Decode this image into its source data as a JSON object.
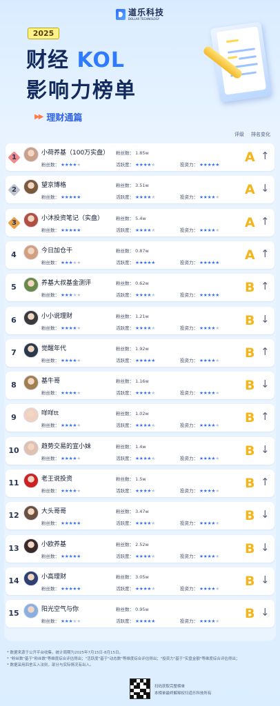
{
  "brand": {
    "cn": "道乐科技",
    "en": "DOLLAR TECHNOLOGY"
  },
  "year": "2025",
  "title": {
    "line1_a": "财经",
    "line1_b": "KOL",
    "line2": "影响力榜单"
  },
  "subtitle": "理财通篇",
  "columns": {
    "grade": "评级",
    "change": "排名变化"
  },
  "labels": {
    "fans": "粉丝数：",
    "fans_short": "粉丝数：",
    "active": "活跃度：",
    "invest": "投资力："
  },
  "rows": [
    {
      "rank": "1",
      "name": "小荷养基（100万实盘）",
      "fans": "1.85w",
      "s1": 4,
      "s2": 4,
      "s3": 5,
      "grade": "A",
      "trend": "↑"
    },
    {
      "rank": "2",
      "name": "望京博格",
      "fans": "3.51w",
      "s1": 5,
      "s2": 4,
      "s3": 4,
      "grade": "A",
      "trend": "↓"
    },
    {
      "rank": "3",
      "name": "小沐投资笔记（实盘）",
      "fans": "5.4w",
      "s1": 5,
      "s2": 4,
      "s3": 4,
      "grade": "A",
      "trend": "↑"
    },
    {
      "rank": "4",
      "name": "今日加仓干",
      "fans": "0.87w",
      "s1": 3,
      "s2": 5,
      "s3": 5,
      "grade": "A",
      "trend": "↑"
    },
    {
      "rank": "5",
      "name": "养基大叔基金测评",
      "fans": "0.62w",
      "s1": 3,
      "s2": 4,
      "s3": 5,
      "grade": "B",
      "trend": "↑"
    },
    {
      "rank": "6",
      "name": "小小说理财",
      "fans": "1.21w",
      "s1": 4,
      "s2": 4,
      "s3": 4,
      "grade": "B",
      "trend": "↓"
    },
    {
      "rank": "7",
      "name": "觉醒年代",
      "fans": "1.92w",
      "s1": 4,
      "s2": 5,
      "s3": 4,
      "grade": "B",
      "trend": "↑"
    },
    {
      "rank": "8",
      "name": "基牛哥",
      "fans": "1.16w",
      "s1": 4,
      "s2": 4,
      "s3": 4,
      "grade": "B",
      "trend": "↓"
    },
    {
      "rank": "9",
      "name": "咩咩tt",
      "fans": "1.02w",
      "s1": 4,
      "s2": 4,
      "s3": 4,
      "grade": "B",
      "trend": "↑"
    },
    {
      "rank": "10",
      "name": "趋势交易的宣小妹",
      "fans": "1.4w",
      "s1": 4,
      "s2": 4,
      "s3": 4,
      "grade": "B",
      "trend": "↓"
    },
    {
      "rank": "11",
      "name": "老王说投资",
      "fans": "1.5w",
      "s1": 4,
      "s2": 4,
      "s3": 4,
      "grade": "B",
      "trend": "↑"
    },
    {
      "rank": "12",
      "name": "大头哥哥",
      "fans": "3.47w",
      "s1": 5,
      "s2": 4,
      "s3": 4,
      "grade": "B",
      "trend": "↓"
    },
    {
      "rank": "13",
      "name": "小欧养基",
      "fans": "2.52w",
      "s1": 5,
      "s2": 4,
      "s3": 4,
      "grade": "B",
      "trend": "↓"
    },
    {
      "rank": "14",
      "name": "小高理财",
      "fans": "3.05w",
      "s1": 5,
      "s2": 4,
      "s3": 4,
      "grade": "B",
      "trend": "↓"
    },
    {
      "rank": "15",
      "name": "阳光空气与你",
      "fans": "0.95w",
      "s1": 3,
      "s2": 5,
      "s3": 4,
      "grade": "B",
      "trend": "↓"
    }
  ],
  "notes": [
    "* 数据来源于公开平台收集，统计周期为2025年7月15日-8月15日。",
    "* \"粉丝数\"基于\"粉丝数\"等维度综合评估得出；\"活跃度\"基于\"动态数\"等维度综合评估得出；\"投资力\"基于\"实盘金额\"等维度综合评估得出；",
    "* 数据采用四舍五入法则，部分与实际情况有出入。"
  ],
  "qr": {
    "line1": "扫码获取完整榜单",
    "line2": "本榜单最终解释权归道乐科技所有"
  },
  "colors": {
    "accent": "#2f6cff",
    "grade": "#f3b51c",
    "title": "#132a5e"
  }
}
